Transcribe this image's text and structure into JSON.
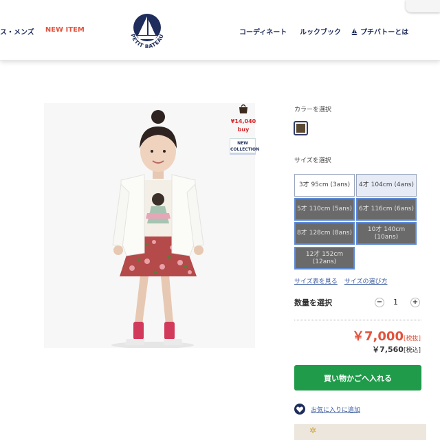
{
  "header": {
    "nav_left": [
      "ス・メンズ",
      "NEW ITEM"
    ],
    "logo_text": "PETIT BATEAU",
    "nav_right": [
      "コーディネート",
      "ルックブック",
      "プチバトーとは"
    ]
  },
  "badge": {
    "price": "¥14,040",
    "buy": "buy",
    "new_line1": "NEW",
    "new_line2": "COLLECTION"
  },
  "color_section": {
    "label": "カラーを選択",
    "selected_color": "#5a4a32"
  },
  "size_section": {
    "label": "サイズを選択",
    "sizes": [
      {
        "text": "3才 95cm (3ans)",
        "state": "available"
      },
      {
        "text": "4才 104cm (4ans)",
        "state": "selected"
      },
      {
        "text": "5才 110cm (5ans)",
        "state": "soldout"
      },
      {
        "text": "6才 116cm (6ans)",
        "state": "soldout"
      },
      {
        "text": "8才 128cm (8ans)",
        "state": "soldout"
      },
      {
        "text": "10才 140cm (10ans)",
        "state": "soldout"
      },
      {
        "text": "12才 152cm (12ans)",
        "state": "soldout"
      }
    ],
    "size_chart_link": "サイズ表を見る",
    "size_guide_link": "サイズの選び方"
  },
  "quantity": {
    "label": "数量を選択",
    "value": "1",
    "minus": "−",
    "plus": "+"
  },
  "price": {
    "main": "￥7,000",
    "main_tax": "[税抜]",
    "sub": "￥7,560",
    "sub_tax": "[税込]"
  },
  "cart_button": "買い物かごへ入れる",
  "favorite_link": "お気に入りに追加",
  "colors": {
    "navy": "#1f2d5c",
    "accent_red": "#e2533d",
    "green": "#1f9b4a"
  }
}
